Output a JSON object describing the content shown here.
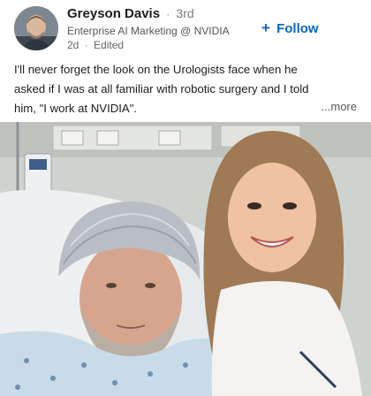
{
  "author": {
    "name": "Greyson Davis",
    "separator": "·",
    "degree": "3rd",
    "headline": "Enterprise AI Marketing @ NVIDIA",
    "time": "2d",
    "edited": "Edited"
  },
  "follow": {
    "plus": "+",
    "label": "Follow"
  },
  "post": {
    "lines": [
      "I'll never forget the look on the Urologists face when he",
      "asked if I was at all familiar with robotic surgery and I told",
      "him, \"I work at NVIDIA\"."
    ],
    "more": "...more"
  },
  "colors": {
    "link": "#0a66c2",
    "text": "#1d1d1d",
    "muted": "#666666"
  }
}
